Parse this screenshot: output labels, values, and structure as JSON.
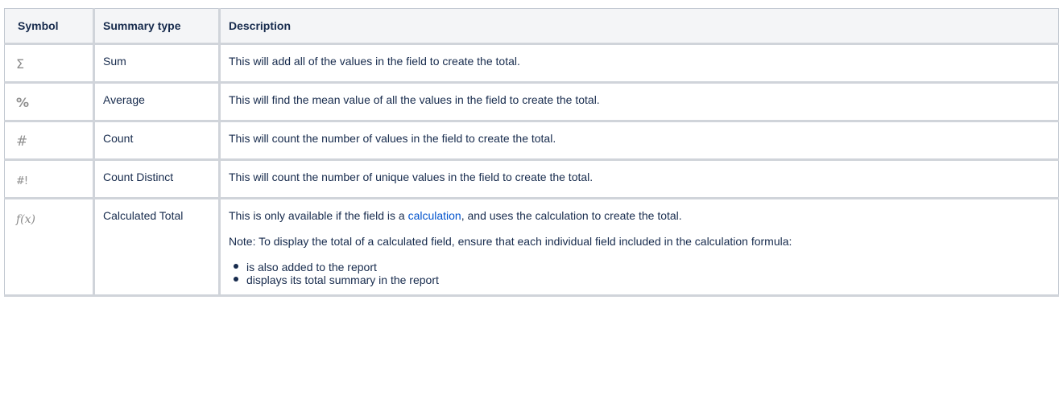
{
  "table": {
    "headers": {
      "symbol": "Symbol",
      "summary_type": "Summary type",
      "description": "Description"
    },
    "rows": [
      {
        "symbol": "Σ",
        "symbol_icon": "sigma-icon",
        "type": "Sum",
        "description": "This will add all of the values in the field to create the total."
      },
      {
        "symbol": "%",
        "symbol_icon": "percent-icon",
        "type": "Average",
        "description": "This will find the mean value of all the values in the field to create the total."
      },
      {
        "symbol": "#",
        "symbol_icon": "hash-icon",
        "type": "Count",
        "description": "This will count the number of values in the field to create the total."
      },
      {
        "symbol": "#!",
        "symbol_icon": "hash-bang-icon",
        "type": "Count Distinct",
        "description": "This will count the number of unique values in the field to create the total."
      },
      {
        "symbol": "f(x)",
        "symbol_icon": "function-icon",
        "type": "Calculated Total",
        "description_before_link": "This is only available if the field is a ",
        "link_text": "calculation",
        "description_after_link": ", and uses the calculation to create the total.",
        "note": "Note: To display the total of a calculated field, ensure that each individual field included in the calculation formula:",
        "bullets": [
          "is also added to the report",
          "displays its total summary in the report"
        ]
      }
    ]
  },
  "colors": {
    "link": "#0052cc",
    "text": "#172b4d",
    "header_bg": "#f4f5f7",
    "border": "#c1c7d0",
    "symbol": "#8c8c8c"
  }
}
